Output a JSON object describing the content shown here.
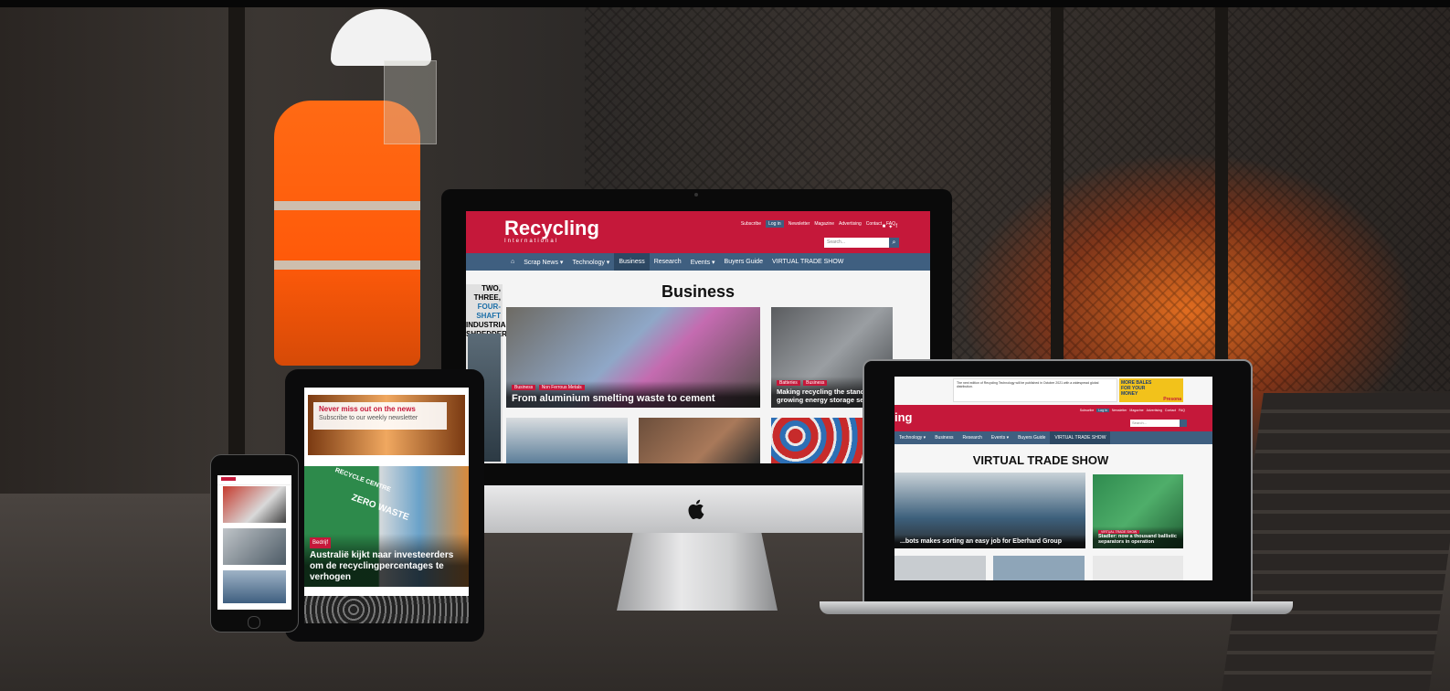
{
  "imac": {
    "logo": "Recycling",
    "logo_sub": "International",
    "top_links": [
      "Subscribe",
      "Log in",
      "Newsletter",
      "Magazine",
      "Advertising",
      "Contact",
      "FAQ"
    ],
    "search_placeholder": "Search...",
    "nav": [
      "Scrap News ▾",
      "Technology ▾",
      "Business",
      "Research",
      "Events ▾",
      "Buyers Guide",
      "VIRTUAL TRADE SHOW"
    ],
    "page_title": "Business",
    "side_ad": [
      "TWO, THREE,",
      "FOUR-SHAFT",
      "INDUSTRIAL",
      "SHREDDERS"
    ],
    "main_card": {
      "tags": [
        "Business",
        "Non Ferrous Metals"
      ],
      "title": "From aluminium smelting waste to cement"
    },
    "side_card": {
      "tags": [
        "Batteries",
        "Business"
      ],
      "title": "Making recycling the standard in growing energy storage sector"
    }
  },
  "laptop": {
    "banner_text": "The next edition of Recycling Technology will be published in October 2021 with a widespread global distribution.",
    "banner_brand": "Recycling Technology",
    "ad": [
      "MORE BALES",
      "FOR YOUR",
      "MONEY",
      "Presona"
    ],
    "logo_fragment": "ing",
    "top_links": [
      "Subscribe",
      "Log in",
      "Newsletter",
      "Magazine",
      "Advertising",
      "Contact",
      "FAQ"
    ],
    "search_placeholder": "Search...",
    "nav": [
      "Technology ▾",
      "Business",
      "Research",
      "Events ▾",
      "Buyers Guide",
      "VIRTUAL TRADE SHOW"
    ],
    "page_title": "VIRTUAL TRADE SHOW",
    "card1": "...bots makes sorting an easy job for Eberhard Group",
    "card2_tag": "VIRTUAL TRADE SHOW",
    "card2": "Stadler: now a thousand ballistic separators in operation"
  },
  "tablet": {
    "newsletter_title": "Never miss out on the news",
    "newsletter_sub": "Subscribe to our weekly newsletter",
    "card_tag": "Bedrijf",
    "card_title": "Australië kijkt naar investeerders om de recyclingpercentages te verhogen",
    "sign": [
      "RECYCLE CENTRE",
      "ZERO WASTE"
    ]
  },
  "colors": {
    "brand_red": "#c5183a",
    "nav_blue": "#3f5f80"
  },
  "icons": [
    "home-icon",
    "search-icon",
    "linkedin-icon",
    "twitter-icon",
    "facebook-icon",
    "apple-logo-icon"
  ]
}
